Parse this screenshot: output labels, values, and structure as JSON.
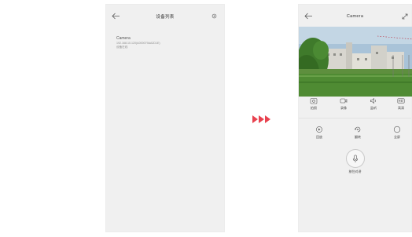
{
  "left_screen": {
    "title": "设备列表",
    "device": {
      "name": "Camera",
      "ip": "192.168.10.120(A000079AA2D1E)",
      "status": "设备在线"
    }
  },
  "right_screen": {
    "title": "Camera",
    "toolbar": [
      {
        "label": "拍照",
        "icon": "camera-icon"
      },
      {
        "label": "录像",
        "icon": "video-icon"
      },
      {
        "label": "监听",
        "icon": "speaker-icon"
      },
      {
        "label": "高清",
        "icon": "hd-icon"
      }
    ],
    "controls": [
      {
        "label": "回放",
        "icon": "playback-icon"
      },
      {
        "label": "翻转",
        "icon": "flip-icon"
      },
      {
        "label": "全屏",
        "icon": "fullscreen-icon"
      }
    ],
    "talk": {
      "label": "按住对讲",
      "icon": "mic-icon"
    }
  },
  "colors": {
    "accent_arrows": "#e8424f",
    "background": "#f0f0f0"
  }
}
